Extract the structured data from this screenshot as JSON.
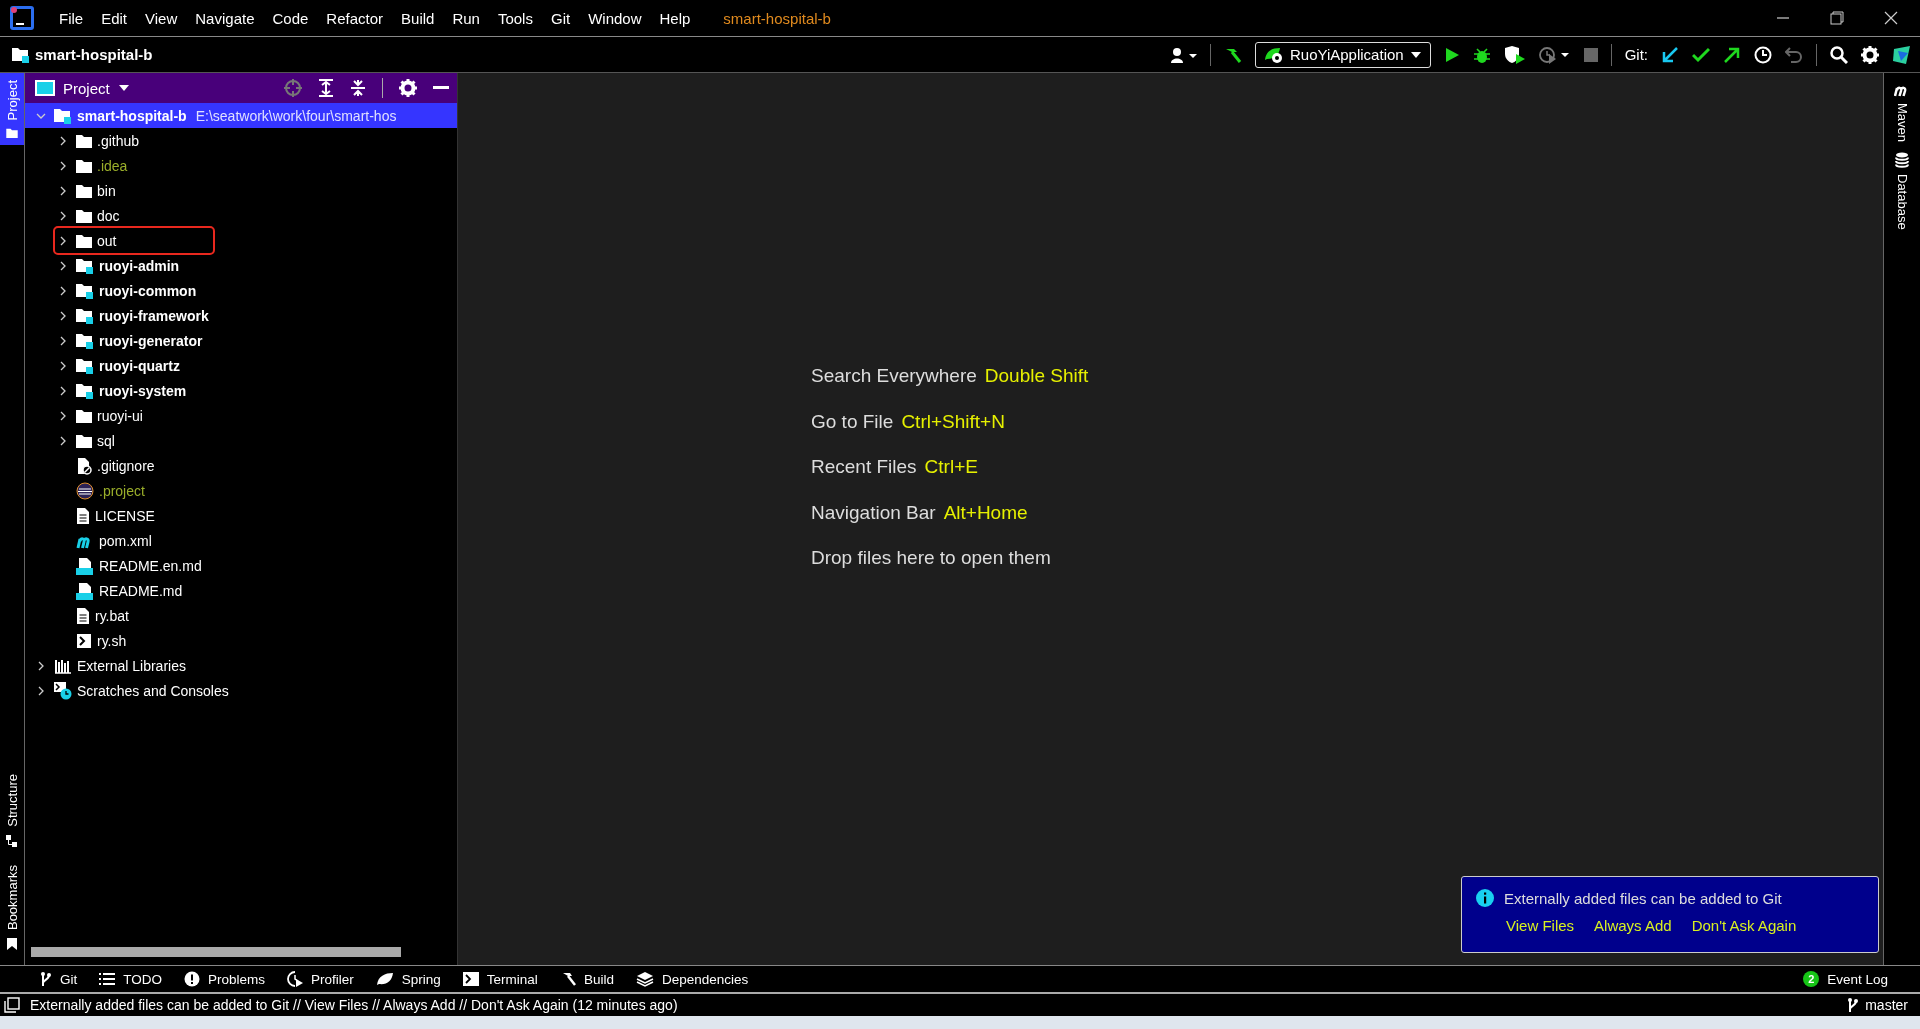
{
  "menu_bar": {
    "items": [
      "File",
      "Edit",
      "View",
      "Navigate",
      "Code",
      "Refactor",
      "Build",
      "Run",
      "Tools",
      "Git",
      "Window",
      "Help"
    ],
    "project_title": "smart-hospital-b"
  },
  "nav_bar": {
    "breadcrumb": "smart-hospital-b",
    "run_config": "RuoYiApplication",
    "git_label": "Git:"
  },
  "left_strip": {
    "top_tabs": [
      {
        "label": "Project",
        "selected": true
      }
    ],
    "bottom_tabs": [
      {
        "label": "Structure",
        "selected": false
      },
      {
        "label": "Bookmarks",
        "selected": false
      }
    ]
  },
  "project_panel": {
    "title": "Project",
    "tree": [
      {
        "name": "smart-hospital-b",
        "path": "E:\\seatwork\\work\\four\\smart-hos",
        "kind": "module",
        "expanded": true,
        "selected": true,
        "children": [
          {
            "name": ".github",
            "kind": "folder",
            "expanded": false,
            "selected": false,
            "ignored": false,
            "highlighted": false
          },
          {
            "name": ".idea",
            "kind": "folder",
            "expanded": false,
            "selected": false,
            "ignored": true,
            "highlighted": false
          },
          {
            "name": "bin",
            "kind": "folder",
            "expanded": false,
            "selected": false,
            "ignored": false,
            "highlighted": false
          },
          {
            "name": "doc",
            "kind": "folder",
            "expanded": false,
            "selected": false,
            "ignored": false,
            "highlighted": false
          },
          {
            "name": "out",
            "kind": "folder",
            "expanded": false,
            "selected": false,
            "ignored": false,
            "highlighted": true
          },
          {
            "name": "ruoyi-admin",
            "kind": "module",
            "expanded": false,
            "selected": false,
            "ignored": false,
            "highlighted": false
          },
          {
            "name": "ruoyi-common",
            "kind": "module",
            "expanded": false,
            "selected": false,
            "ignored": false,
            "highlighted": false
          },
          {
            "name": "ruoyi-framework",
            "kind": "module",
            "expanded": false,
            "selected": false,
            "ignored": false,
            "highlighted": false
          },
          {
            "name": "ruoyi-generator",
            "kind": "module",
            "expanded": false,
            "selected": false,
            "ignored": false,
            "highlighted": false
          },
          {
            "name": "ruoyi-quartz",
            "kind": "module",
            "expanded": false,
            "selected": false,
            "ignored": false,
            "highlighted": false
          },
          {
            "name": "ruoyi-system",
            "kind": "module",
            "expanded": false,
            "selected": false,
            "ignored": false,
            "highlighted": false
          },
          {
            "name": "ruoyi-ui",
            "kind": "folder",
            "expanded": false,
            "selected": false,
            "ignored": false,
            "highlighted": false
          },
          {
            "name": "sql",
            "kind": "folder",
            "expanded": false,
            "selected": false,
            "ignored": false,
            "highlighted": false
          },
          {
            "name": ".gitignore",
            "kind": "gitignore",
            "selected": false,
            "ignored": false,
            "highlighted": false
          },
          {
            "name": ".project",
            "kind": "eclipse",
            "selected": false,
            "ignored": true,
            "highlighted": false
          },
          {
            "name": "LICENSE",
            "kind": "text",
            "selected": false,
            "ignored": false,
            "highlighted": false
          },
          {
            "name": "pom.xml",
            "kind": "maven",
            "selected": false,
            "ignored": false,
            "highlighted": false
          },
          {
            "name": "README.en.md",
            "kind": "markdown",
            "selected": false,
            "ignored": false,
            "highlighted": false
          },
          {
            "name": "README.md",
            "kind": "markdown",
            "selected": false,
            "ignored": false,
            "highlighted": false
          },
          {
            "name": "ry.bat",
            "kind": "text",
            "selected": false,
            "ignored": false,
            "highlighted": false
          },
          {
            "name": "ry.sh",
            "kind": "shell",
            "selected": false,
            "ignored": false,
            "highlighted": false
          }
        ]
      },
      {
        "name": "External Libraries",
        "kind": "libraries",
        "expanded": false,
        "selected": false
      },
      {
        "name": "Scratches and Consoles",
        "kind": "scratches",
        "expanded": false,
        "selected": false
      }
    ]
  },
  "editor": {
    "hints": [
      {
        "action": "Search Everywhere",
        "shortcut": "Double Shift"
      },
      {
        "action": "Go to File",
        "shortcut": "Ctrl+Shift+N"
      },
      {
        "action": "Recent Files",
        "shortcut": "Ctrl+E"
      },
      {
        "action": "Navigation Bar",
        "shortcut": "Alt+Home"
      },
      {
        "action": "Drop files here to open them"
      }
    ]
  },
  "notification": {
    "message": "Externally added files can be added to Git",
    "actions": [
      "View Files",
      "Always Add",
      "Don't Ask Again"
    ]
  },
  "right_strip": {
    "tabs": [
      {
        "label": "Maven",
        "kind": "maven"
      },
      {
        "label": "Database",
        "kind": "database"
      }
    ]
  },
  "tool_bar": {
    "tabs": [
      {
        "label": "Git",
        "kind": "branch"
      },
      {
        "label": "TODO",
        "kind": "list"
      },
      {
        "label": "Problems",
        "kind": "problems"
      },
      {
        "label": "Profiler",
        "kind": "profiler"
      },
      {
        "label": "Spring",
        "kind": "spring"
      },
      {
        "label": "Terminal",
        "kind": "terminal"
      },
      {
        "label": "Build",
        "kind": "build"
      },
      {
        "label": "Dependencies",
        "kind": "dependencies"
      }
    ],
    "event_log": {
      "count": "2",
      "label": "Event Log"
    }
  },
  "status_bar": {
    "message": "Externally added files can be added to Git // View Files // Always Add // Don't Ask Again (12 minutes ago)",
    "branch": "master"
  }
}
